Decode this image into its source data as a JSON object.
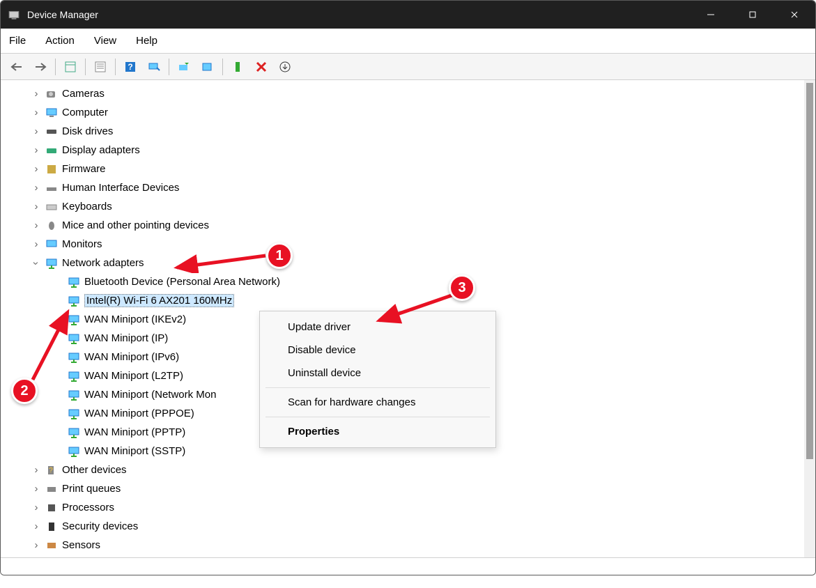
{
  "window": {
    "title": "Device Manager"
  },
  "menu": {
    "file": "File",
    "action": "Action",
    "view": "View",
    "help": "Help"
  },
  "tree": {
    "categories": [
      {
        "label": "Cameras",
        "expanded": false,
        "icon": "camera"
      },
      {
        "label": "Computer",
        "expanded": false,
        "icon": "computer"
      },
      {
        "label": "Disk drives",
        "expanded": false,
        "icon": "disk"
      },
      {
        "label": "Display adapters",
        "expanded": false,
        "icon": "display"
      },
      {
        "label": "Firmware",
        "expanded": false,
        "icon": "firmware"
      },
      {
        "label": "Human Interface Devices",
        "expanded": false,
        "icon": "hid"
      },
      {
        "label": "Keyboards",
        "expanded": false,
        "icon": "keyboard"
      },
      {
        "label": "Mice and other pointing devices",
        "expanded": false,
        "icon": "mouse"
      },
      {
        "label": "Monitors",
        "expanded": false,
        "icon": "monitor"
      },
      {
        "label": "Network adapters",
        "expanded": true,
        "icon": "network",
        "children": [
          {
            "label": "Bluetooth Device (Personal Area Network)"
          },
          {
            "label": "Intel(R) Wi-Fi 6 AX201 160MHz",
            "selected": true
          },
          {
            "label": "WAN Miniport (IKEv2)"
          },
          {
            "label": "WAN Miniport (IP)"
          },
          {
            "label": "WAN Miniport (IPv6)"
          },
          {
            "label": "WAN Miniport (L2TP)"
          },
          {
            "label": "WAN Miniport (Network Mon"
          },
          {
            "label": "WAN Miniport (PPPOE)"
          },
          {
            "label": "WAN Miniport (PPTP)"
          },
          {
            "label": "WAN Miniport (SSTP)"
          }
        ]
      },
      {
        "label": "Other devices",
        "expanded": false,
        "icon": "other"
      },
      {
        "label": "Print queues",
        "expanded": false,
        "icon": "print"
      },
      {
        "label": "Processors",
        "expanded": false,
        "icon": "cpu"
      },
      {
        "label": "Security devices",
        "expanded": false,
        "icon": "security"
      },
      {
        "label": "Sensors",
        "expanded": false,
        "icon": "sensor"
      }
    ]
  },
  "context_menu": {
    "update": "Update driver",
    "disable": "Disable device",
    "uninstall": "Uninstall device",
    "scan": "Scan for hardware changes",
    "properties": "Properties"
  },
  "annotations": {
    "a1": "1",
    "a2": "2",
    "a3": "3"
  }
}
